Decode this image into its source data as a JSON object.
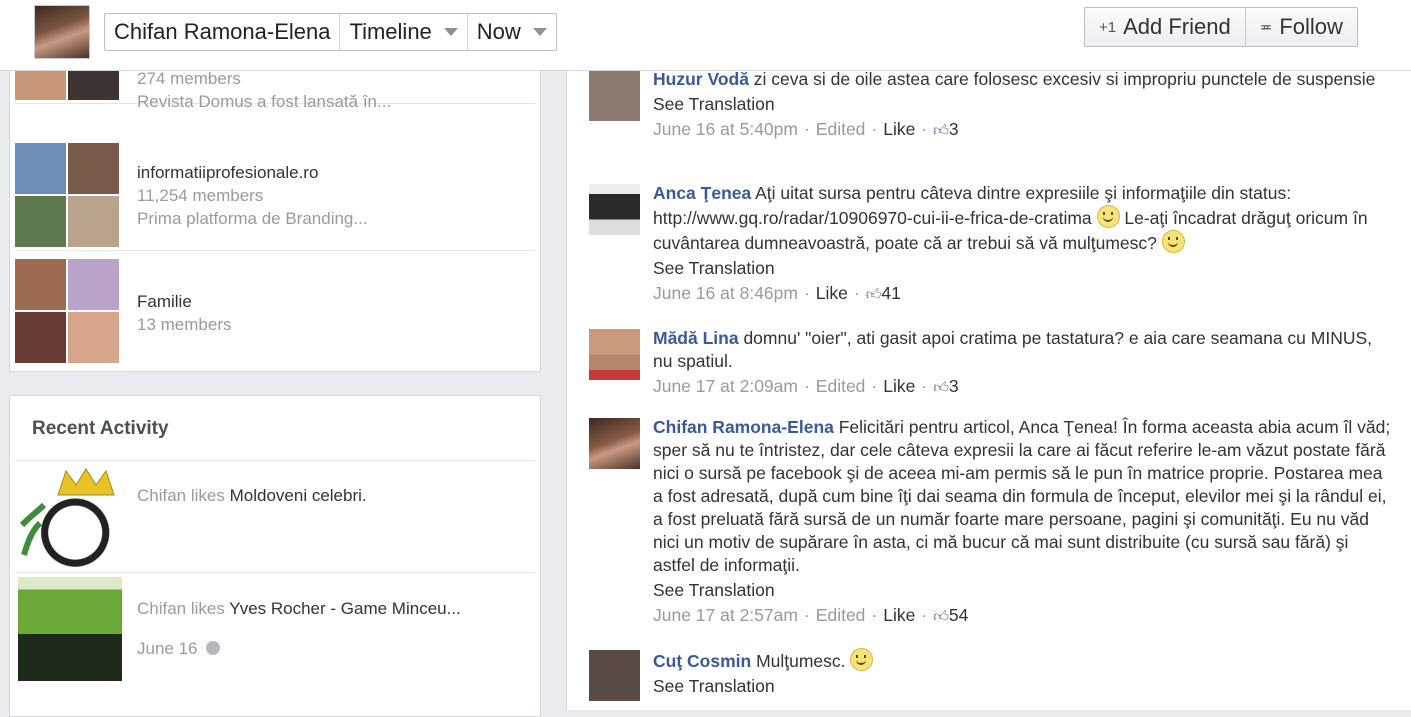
{
  "header": {
    "profile_name": "Chifan Ramona-Elena",
    "timeline_label": "Timeline",
    "now_label": "Now",
    "add_friend_label": "Add Friend",
    "follow_label": "Follow"
  },
  "groups": [
    {
      "name": "",
      "members": "274 members",
      "desc": "Revista Domus a fost lansată în...",
      "colors": [
        "#b07a5c",
        "#6b5a4a",
        "#c89778",
        "#3d3330"
      ]
    },
    {
      "name": "informatiiprofesionale.ro",
      "members": "11,254 members",
      "desc": "Prima platforma de Branding...",
      "colors": [
        "#6e8fb8",
        "#7a5a4a",
        "#5f7a4e",
        "#b8a48c"
      ]
    },
    {
      "name": "Familie",
      "members": "13 members",
      "desc": "",
      "colors": [
        "#9c6b52",
        "#b9a3c8",
        "#6a3b36",
        "#d7a68a"
      ]
    }
  ],
  "recent_activity": {
    "title": "Recent Activity",
    "items": [
      {
        "prefix": "Chifan likes ",
        "target": "Moldoveni celebri.",
        "date": ""
      },
      {
        "prefix": "Chifan likes ",
        "target": "Yves Rocher - Game Minceu...",
        "date": "June 16"
      }
    ]
  },
  "comments": [
    {
      "author": "Huzur Vodă",
      "text": " zi ceva si de oile astea care folosesc excesiv si impropriu punctele de suspensie",
      "see_translation": "See Translation",
      "time": "June 16 at 5:40pm",
      "edited": "Edited",
      "like": "Like",
      "likes": "3",
      "avatar_color": "#8a7a70"
    },
    {
      "author": "Anca Ţenea",
      "text_a": " Aţi uitat sursa pentru câteva dintre expresiile şi informaţiile din status: ",
      "link": "http://www.gq.ro/radar/10906970-cui-ii-e-frica-de-cratima",
      "text_b": " Le-aţi încadrat drăguţ oricum în cuvântarea dumneavoastră, poate că ar trebui să vă mulţumesc? ",
      "see_translation": "See Translation",
      "time": "June 16 at 8:46pm",
      "like": "Like",
      "likes": "41",
      "avatar_color": "#2d2a2a"
    },
    {
      "author": "Mădă Lina",
      "text": " domnu' \"oier\", ati gasit apoi cratima pe tastatura? e aia care seamana cu MINUS, nu spatiul.",
      "time": "June 17 at 2:09am",
      "edited": "Edited",
      "like": "Like",
      "likes": "3",
      "avatar_color": "#b4876c"
    },
    {
      "author": "Chifan Ramona-Elena",
      "text": " Felicitări pentru articol, Anca Ţenea! În forma aceasta abia acum îl văd; sper să nu te întristez, dar cele câteva expresii la care ai făcut referire le-am văzut postate fără nici o sursă pe facebook şi de aceea mi-am permis să le pun în matrice proprie. Postarea mea a fost adresată, după cum bine îţi dai seama din formula de început, elevilor mei şi la rândul ei, a fost preluată fără sursă de un număr foarte mare persoane, pagini şi comunităţi. Eu nu văd nici un motiv de supărare în asta, ci mă bucur că mai sunt distribuite (cu sursă sau fără) şi astfel de informaţii.",
      "see_translation": "See Translation",
      "time": "June 17 at 2:57am",
      "edited": "Edited",
      "like": "Like",
      "likes": "54",
      "avatar_color": "#6a4636"
    },
    {
      "author": "Cuţ Cosmin",
      "text": " Mulţumesc. ",
      "see_translation": "See Translation",
      "avatar_color": "#5a4a44"
    }
  ]
}
